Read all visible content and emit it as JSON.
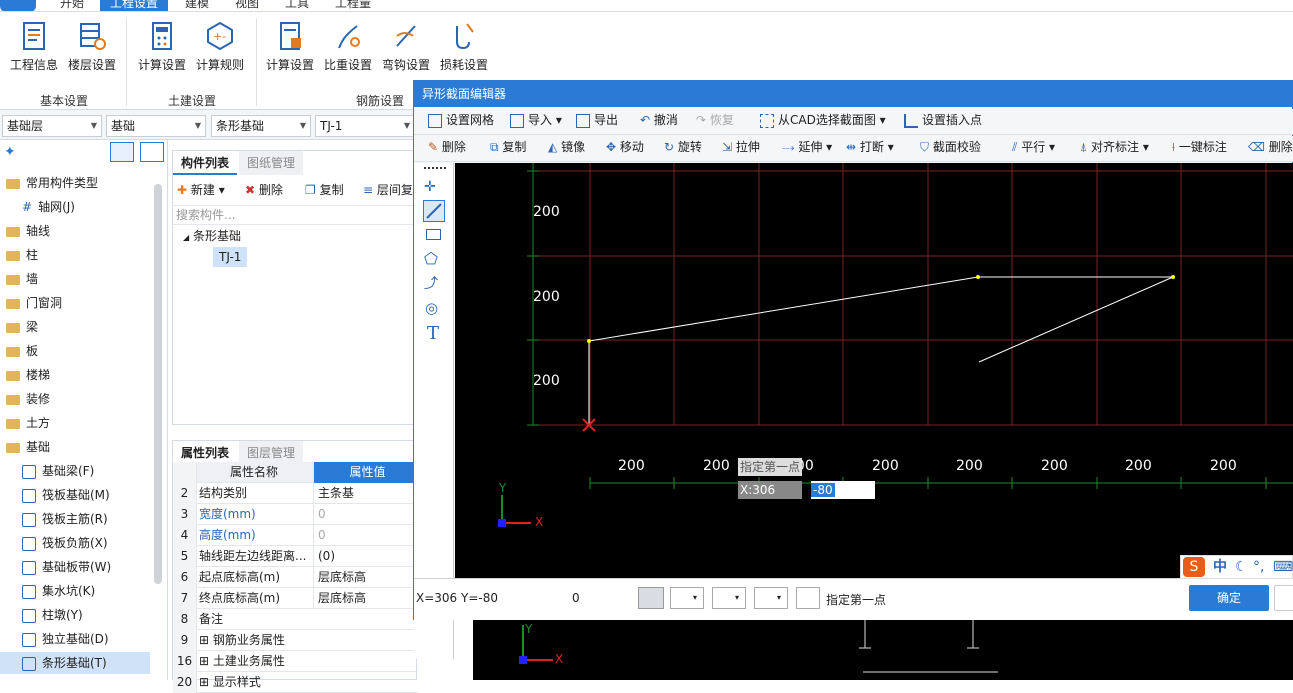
{
  "menu": {
    "tabs": [
      "开始",
      "工程设置",
      "建模",
      "视图",
      "工具",
      "工程量"
    ],
    "active": "工程设置"
  },
  "ribbon": {
    "buttons": [
      "工程信息",
      "楼层设置",
      "计算设置",
      "计算规则",
      "计算设置",
      "比重设置",
      "弯钩设置",
      "损耗设置"
    ],
    "groups": [
      "基本设置",
      "土建设置",
      "钢筋设置"
    ]
  },
  "selectors": {
    "floor": "基础层",
    "category": "基础",
    "type": "条形基础",
    "item": "TJ-1"
  },
  "tree": {
    "items": [
      "常用构件类型",
      "轴网(J)",
      "轴线",
      "柱",
      "墙",
      "门窗洞",
      "梁",
      "板",
      "楼梯",
      "装修",
      "土方",
      "基础"
    ],
    "base_children": [
      "基础梁(F)",
      "筏板基础(M)",
      "筏板主筋(R)",
      "筏板负筋(X)",
      "基础板带(W)",
      "集水坑(K)",
      "柱墩(Y)",
      "独立基础(D)",
      "条形基础(T)"
    ]
  },
  "component_list": {
    "tabs": [
      "构件列表",
      "图纸管理"
    ],
    "toolbar": [
      "新建",
      "删除",
      "复制",
      "层间复"
    ],
    "search_placeholder": "搜索构件...",
    "root": "条形基础",
    "selected": "TJ-1"
  },
  "properties": {
    "tabs": [
      "属性列表",
      "图层管理"
    ],
    "header_name": "属性名称",
    "header_value": "属性值",
    "rows": [
      {
        "num": "2",
        "name": "结构类别",
        "value": "主条基"
      },
      {
        "num": "3",
        "name": "宽度(mm)",
        "value": "0"
      },
      {
        "num": "4",
        "name": "高度(mm)",
        "value": "0"
      },
      {
        "num": "5",
        "name": "轴线距左边线距离...",
        "value": "(0)"
      },
      {
        "num": "6",
        "name": "起点底标高(m)",
        "value": "层底标高"
      },
      {
        "num": "7",
        "name": "终点底标高(m)",
        "value": "层底标高"
      },
      {
        "num": "8",
        "name": "备注",
        "value": ""
      },
      {
        "num": "9",
        "name": "钢筋业务属性",
        "value": ""
      },
      {
        "num": "16",
        "name": "土建业务属性",
        "value": ""
      },
      {
        "num": "20",
        "name": "显示样式",
        "value": ""
      }
    ]
  },
  "dialog": {
    "title": "异形截面编辑器",
    "toolbar1": [
      "设置网格",
      "导入",
      "导出",
      "撤消",
      "恢复",
      "从CAD选择截面图",
      "设置插入点"
    ],
    "toolbar2": [
      "删除",
      "复制",
      "镜像",
      "移动",
      "旋转",
      "拉伸",
      "延伸",
      "打断",
      "截面校验",
      "平行",
      "对齐标注",
      "一键标注",
      "删除"
    ],
    "grid_labels_y": [
      "200",
      "200",
      "200"
    ],
    "grid_labels_x": [
      "200",
      "200",
      "200",
      "200",
      "200",
      "200",
      "200",
      "200"
    ],
    "hint": "指定第一点",
    "coord_x_label": "X:306",
    "coord_y_value": "-80",
    "status_coords": "X=306 Y=-80",
    "status_zero": "0",
    "status_hint": "指定第一点",
    "ok": "确定",
    "axis_x": "X",
    "axis_y": "Y"
  },
  "ime": {
    "lang": "中"
  },
  "colors": {
    "accent": "#2a7bd6",
    "grid_red": "#7a2222",
    "grid_green": "#1f8a2a",
    "line": "#ffffff",
    "vertex": "#ffff00"
  }
}
